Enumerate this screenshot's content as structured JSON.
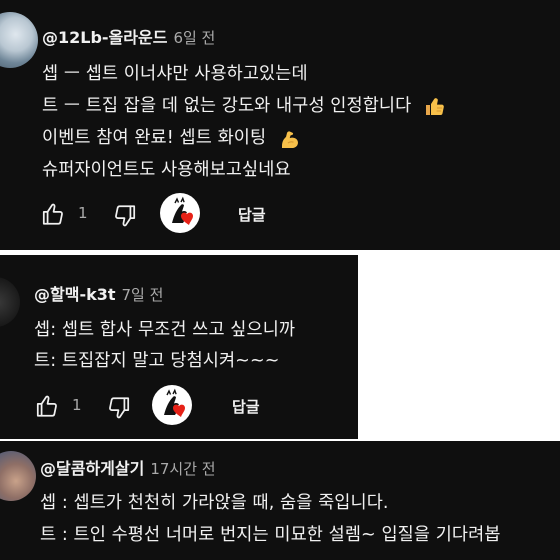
{
  "comments": [
    {
      "handle": "@12Lb-올라운드",
      "time": "6일 전",
      "lines": [
        "셉 ㅡ 셉트 이너샤만 사용하고있는데",
        "트 ㅡ 트집 잡을 데 없는 강도와 내구성 인정합니다",
        "이벤트 참여 완료! 셉트 화이팅",
        "슈퍼자이언트도 사용해보고싶네요"
      ],
      "likes": "1",
      "reply_label": "답글"
    },
    {
      "handle": "@할맥-k3t",
      "time": "7일 전",
      "lines": [
        "셉: 셉트 합사 무조건 쓰고 싶으니까",
        "트: 트집잡지 말고 당첨시켜~~~"
      ],
      "likes": "1",
      "reply_label": "답글"
    },
    {
      "handle": "@달콤하게살기",
      "time": "17시간 전",
      "lines": [
        "셉 : 셉트가 천천히 가라앉을 때, 숨을 죽입니다.",
        "트 : 트인 수평선 너머로 번지는 미묘한 설렘~ 입질을 기다려봅"
      ]
    }
  ],
  "icons": {
    "like": "thumbs-up-icon",
    "dislike": "thumbs-down-icon",
    "creator_heart": "creator-heart-icon",
    "thumbs_emoji": "thumbs-up-emoji",
    "muscle_emoji": "flexed-biceps-emoji"
  },
  "colors": {
    "background": "#0f0f0f",
    "text": "#f1f1f1",
    "secondary_text": "#aaaaaa",
    "heart": "#e62117"
  }
}
